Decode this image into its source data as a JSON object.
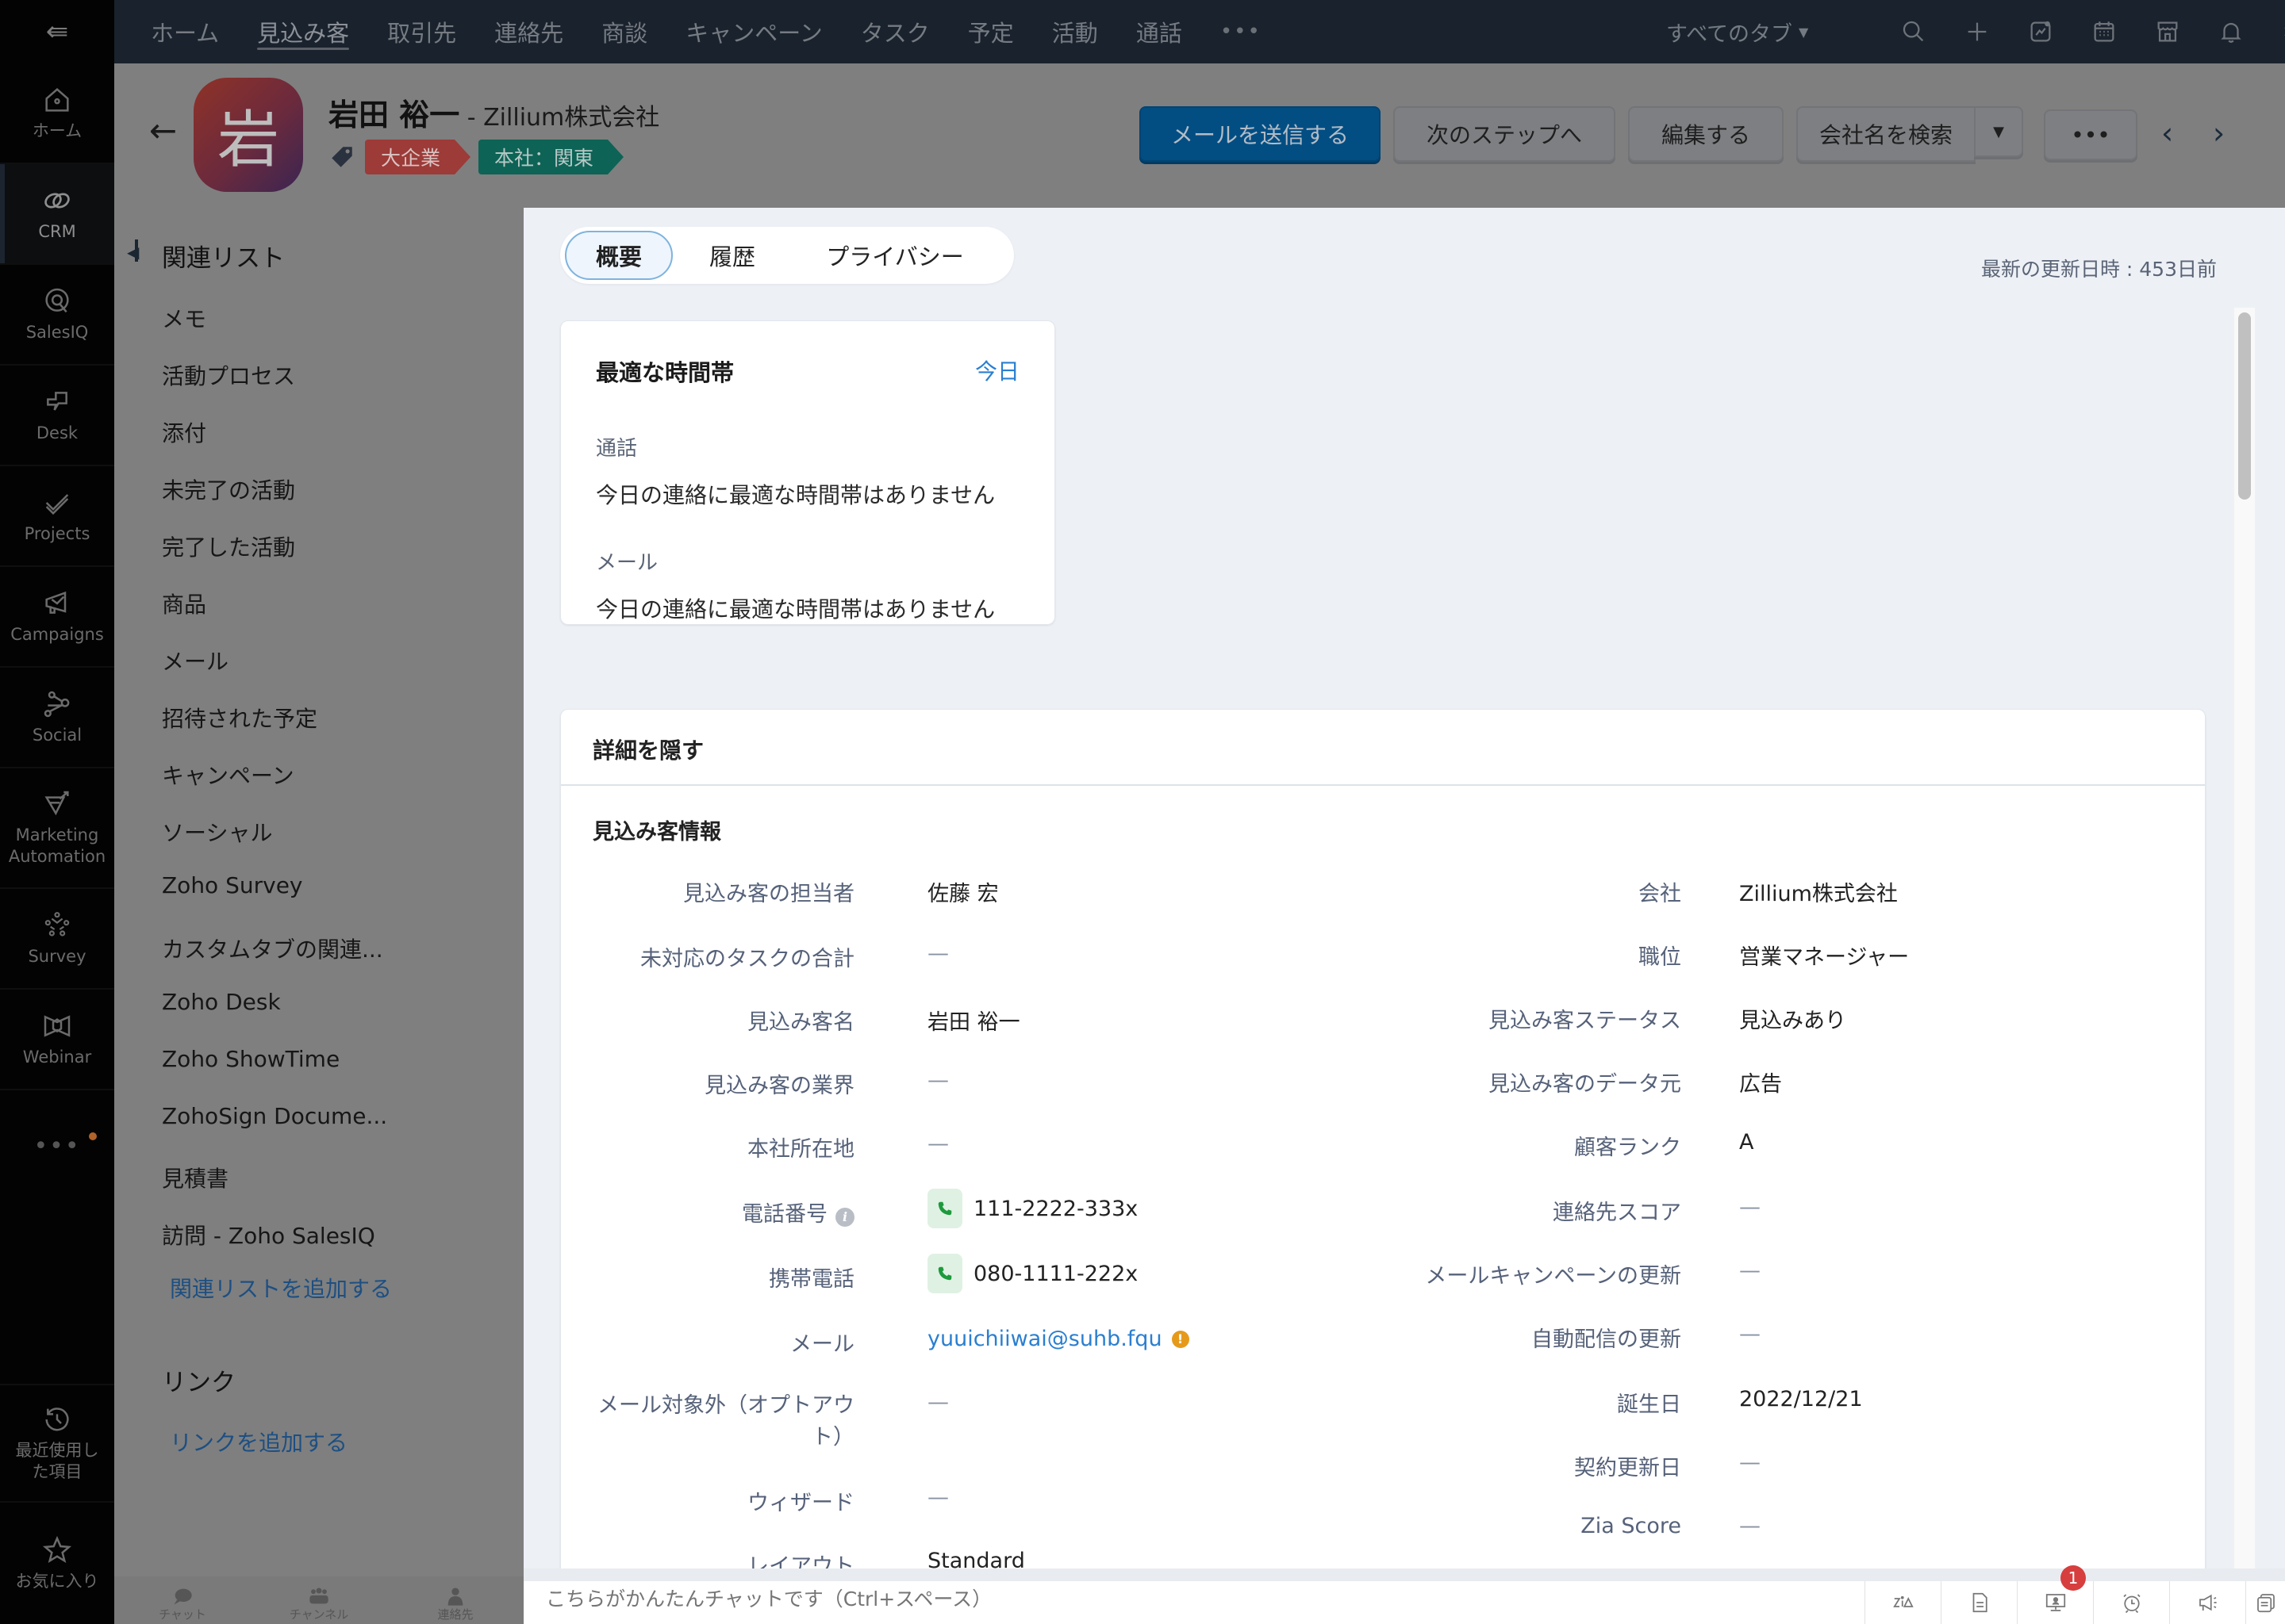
{
  "rail": {
    "items": [
      {
        "label": "ホーム",
        "icon": "home-icon"
      },
      {
        "label": "CRM",
        "icon": "crm-icon",
        "active": true
      },
      {
        "label": "SalesIQ",
        "icon": "salesiq-icon"
      },
      {
        "label": "Desk",
        "icon": "desk-icon"
      },
      {
        "label": "Projects",
        "icon": "projects-icon"
      },
      {
        "label": "Campaigns",
        "icon": "campaigns-icon"
      },
      {
        "label": "Social",
        "icon": "social-icon"
      },
      {
        "label": "Marketing Automation",
        "icon": "marketing-automation-icon"
      },
      {
        "label": "Survey",
        "icon": "survey-icon"
      },
      {
        "label": "Webinar",
        "icon": "webinar-icon"
      }
    ],
    "more_label": "•••",
    "recent_label": "最近使用した項目",
    "favorites_label": "お気に入り"
  },
  "topnav": {
    "tabs": [
      "ホーム",
      "見込み客",
      "取引先",
      "連絡先",
      "商談",
      "キャンペーン",
      "タスク",
      "予定",
      "活動",
      "通話"
    ],
    "active_tab": "見込み客",
    "more_label": "•••",
    "all_tabs_label": "すべてのタブ",
    "icons": [
      "search-icon",
      "plus-icon",
      "analytics-icon",
      "calendar-icon",
      "marketplace-icon",
      "bell-icon",
      "gear-icon"
    ]
  },
  "record": {
    "avatar_initial": "岩",
    "name": "岩田 裕一",
    "company_suffix": " - Zillium株式会社",
    "tags": [
      "大企業",
      "本社：関東"
    ],
    "buttons": {
      "send_mail": "メールを送信する",
      "next_step": "次のステップへ",
      "edit": "編集する",
      "search_company": "会社名を検索",
      "more": "•••"
    }
  },
  "related": {
    "title": "関連リスト",
    "items": [
      "メモ",
      "活動プロセス",
      "添付",
      "未完了の活動",
      "完了した活動",
      "商品",
      "メール",
      "招待された予定",
      "キャンペーン",
      "ソーシャル",
      "Zoho Survey",
      "カスタムタブの関連...",
      "Zoho Desk",
      "Zoho ShowTime",
      "ZohoSign Docume...",
      "見積書",
      "訪問 - Zoho SalesIQ"
    ],
    "add_related_label": "関連リストを追加する",
    "links_title": "リンク",
    "add_link_label": "リンクを追加する"
  },
  "main": {
    "tabs": [
      "概要",
      "履歴",
      "プライバシー"
    ],
    "active_tab": "概要",
    "last_updated": "最新の更新日時 : 453日前",
    "best_time": {
      "title": "最適な時間帯",
      "today_label": "今日",
      "call_label": "通話",
      "call_text": "今日の連絡に最適な時間帯はありません",
      "mail_label": "メール",
      "mail_text": "今日の連絡に最適な時間帯はありません"
    },
    "details": {
      "hide_label": "詳細を隠す",
      "section_title": "見込み客情報",
      "left_fields": [
        {
          "label": "見込み客の担当者",
          "value": "佐藤 宏"
        },
        {
          "label": "未対応のタスクの合計",
          "value": "—"
        },
        {
          "label": "見込み客名",
          "value": "岩田 裕一"
        },
        {
          "label": "見込み客の業界",
          "value": "—"
        },
        {
          "label": "本社所在地",
          "value": "—"
        },
        {
          "label": "電話番号",
          "value": "111-2222-333x"
        },
        {
          "label": "携帯電話",
          "value": "080-1111-222x"
        },
        {
          "label": "メール",
          "value": "yuuichiiwai@suhb.fqu"
        },
        {
          "label": "メール対象外（オプトアウト）",
          "value": "—"
        },
        {
          "label": "ウィザード",
          "value": "—"
        },
        {
          "label": "レイアウト",
          "value": "Standard"
        }
      ],
      "right_fields": [
        {
          "label": "会社",
          "value": "Zillium株式会社"
        },
        {
          "label": "職位",
          "value": "営業マネージャー"
        },
        {
          "label": "見込み客ステータス",
          "value": "見込みあり"
        },
        {
          "label": "見込み客のデータ元",
          "value": "広告"
        },
        {
          "label": "顧客ランク",
          "value": "A"
        },
        {
          "label": "連絡先スコア",
          "value": "—"
        },
        {
          "label": "メールキャンペーンの更新",
          "value": "—"
        },
        {
          "label": "自動配信の更新",
          "value": "—"
        },
        {
          "label": "誕生日",
          "value": "2022/12/21"
        },
        {
          "label": "契約更新日",
          "value": "—"
        },
        {
          "label": "Zia Score",
          "value": "—"
        }
      ]
    }
  },
  "bottom": {
    "chat_label": "チャット",
    "channel_label": "チャンネル",
    "contacts_label": "連絡先",
    "chat_placeholder": "こちらがかんたんチャットです（Ctrl+スペース）",
    "notification_count": "1"
  },
  "colors": {
    "accent": "#2a7fd0",
    "primary_button": "#024e83",
    "tag_red": "#9c3b38",
    "tag_teal": "#0d6356",
    "badge": "#d73e3e"
  }
}
